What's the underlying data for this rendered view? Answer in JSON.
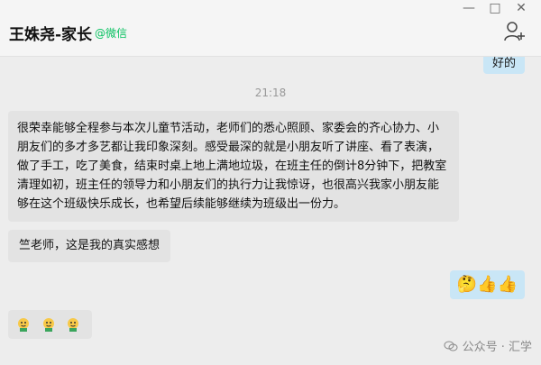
{
  "header": {
    "title": "王姝尧-家长",
    "tag": "@微信",
    "add_user_icon": "add-user-icon"
  },
  "window_controls": [
    "—",
    "□",
    "✕"
  ],
  "chat": {
    "partial_prev": "好的",
    "time": "21:18",
    "msg1": "很荣幸能够全程参与本次儿童节活动，老师们的悉心照顾、家委会的齐心协力、小朋友们的多才多艺都让我印象深刻。感受最深的就是小朋友听了讲座、看了表演，做了手工，吃了美食，结束时桌上地上满地垃圾，在班主任的倒计8分钟下，把教室清理如初，班主任的领导力和小朋友们的执行力让我惊讶，也很高兴我家小朋友能够在这个班级快乐成长，也希望后续能够继续为班级出一份力。",
    "msg2": "竺老师，这是我的真实感想",
    "right_emojis": [
      "🤔",
      "👍",
      "👍"
    ],
    "left_emojis": [
      "face-emoji",
      "face-emoji",
      "face-emoji"
    ]
  },
  "watermark": "公众号 · 汇学",
  "colors": {
    "accent_green": "#07c160",
    "bubble_blue": "#c9e6f6",
    "bubble_gray": "#e3e3e3"
  }
}
